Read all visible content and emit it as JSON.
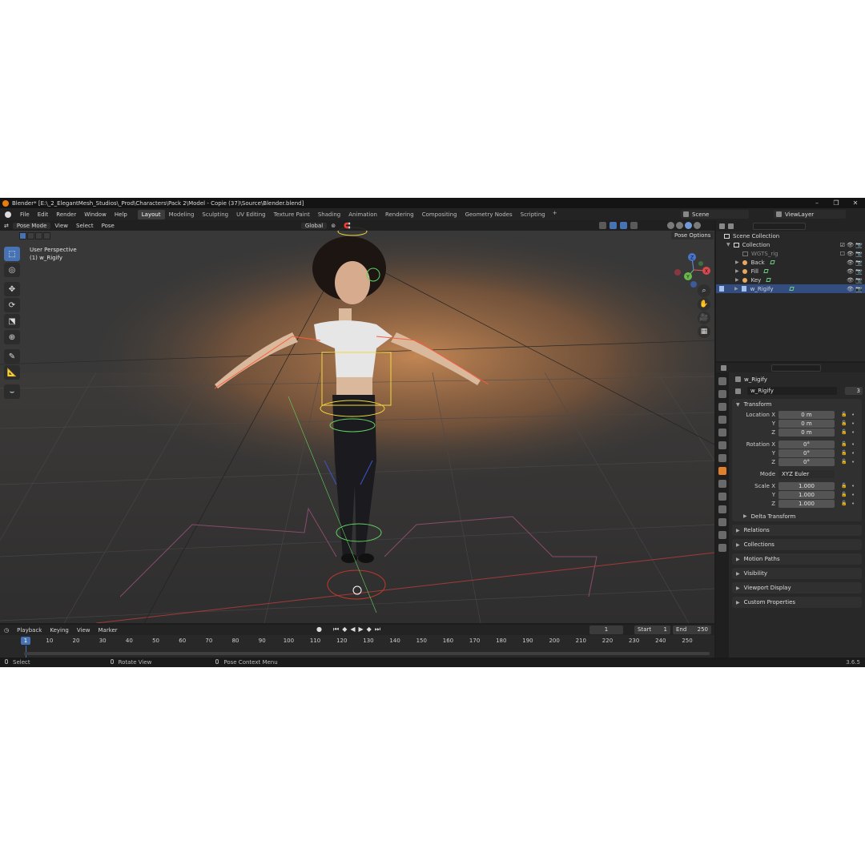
{
  "window": {
    "title": "Blender* [E:\\_2_ElegantMesh_Studios\\_Prod\\Characters\\Pack 2\\Model - Copie (37)\\Source\\Blender.blend]",
    "minimize": "–",
    "maximize": "❐",
    "close": "✕"
  },
  "menu": {
    "items": [
      "File",
      "Edit",
      "Render",
      "Window",
      "Help"
    ]
  },
  "workspaces": {
    "tabs": [
      "Layout",
      "Modeling",
      "Sculpting",
      "UV Editing",
      "Texture Paint",
      "Shading",
      "Animation",
      "Rendering",
      "Compositing",
      "Geometry Nodes",
      "Scripting"
    ],
    "active": "Layout",
    "add": "+"
  },
  "scene": {
    "label": "Scene"
  },
  "view_layer": {
    "label": "ViewLayer"
  },
  "viewport": {
    "mode": "Pose Mode",
    "menus": [
      "View",
      "Select",
      "Pose"
    ],
    "orientation": "Global",
    "perspective_label": "User Perspective",
    "active_object": "(1) w_Rigify",
    "pose_options": "Pose Options",
    "gizmo": {
      "z": "Z",
      "y": "Y",
      "x": "X"
    },
    "nav_icons": [
      "⌕",
      "✋",
      "🎥",
      "▦"
    ]
  },
  "outliner": {
    "rows": [
      {
        "label": "Scene Collection",
        "indent": 0
      },
      {
        "label": "Collection",
        "indent": 1
      },
      {
        "label": "WGTS_rig",
        "indent": 2
      },
      {
        "label": "Back",
        "indent": 2
      },
      {
        "label": "Fill",
        "indent": 2
      },
      {
        "label": "Key",
        "indent": 2
      },
      {
        "label": "w_Rigify",
        "indent": 2
      }
    ]
  },
  "properties": {
    "object_name": "w_Rigify",
    "data_name": "w_Rigify",
    "data_users": "3",
    "transform": {
      "title": "Transform",
      "location_x_label": "Location X",
      "rotation_x_label": "Rotation X",
      "scale_x_label": "Scale X",
      "y_label": "Y",
      "z_label": "Z",
      "mode_label": "Mode",
      "mode_value": "XYZ Euler",
      "location": [
        "0 m",
        "0 m",
        "0 m"
      ],
      "rotation": [
        "0°",
        "0°",
        "0°"
      ],
      "scale": [
        "1.000",
        "1.000",
        "1.000"
      ],
      "delta": "Delta Transform"
    },
    "panels": [
      "Relations",
      "Collections",
      "Motion Paths",
      "Visibility",
      "Viewport Display",
      "Custom Properties"
    ]
  },
  "timeline": {
    "menus": [
      "Playback",
      "Keying",
      "View",
      "Marker"
    ],
    "current_frame": "1",
    "start_label": "Start",
    "start": "1",
    "end_label": "End",
    "end": "250",
    "ticks": [
      "1",
      "10",
      "20",
      "30",
      "40",
      "50",
      "60",
      "70",
      "80",
      "90",
      "100",
      "110",
      "120",
      "130",
      "140",
      "150",
      "160",
      "170",
      "180",
      "190",
      "200",
      "210",
      "220",
      "230",
      "240",
      "250"
    ],
    "cursor_label": "1"
  },
  "status": {
    "select": "Select",
    "rotate": "Rotate View",
    "context": "Pose Context Menu",
    "version": "3.6.5"
  },
  "colors": {
    "accent": "#4772b3",
    "selected_row": "#334d80",
    "orange": "#e07f2c"
  }
}
